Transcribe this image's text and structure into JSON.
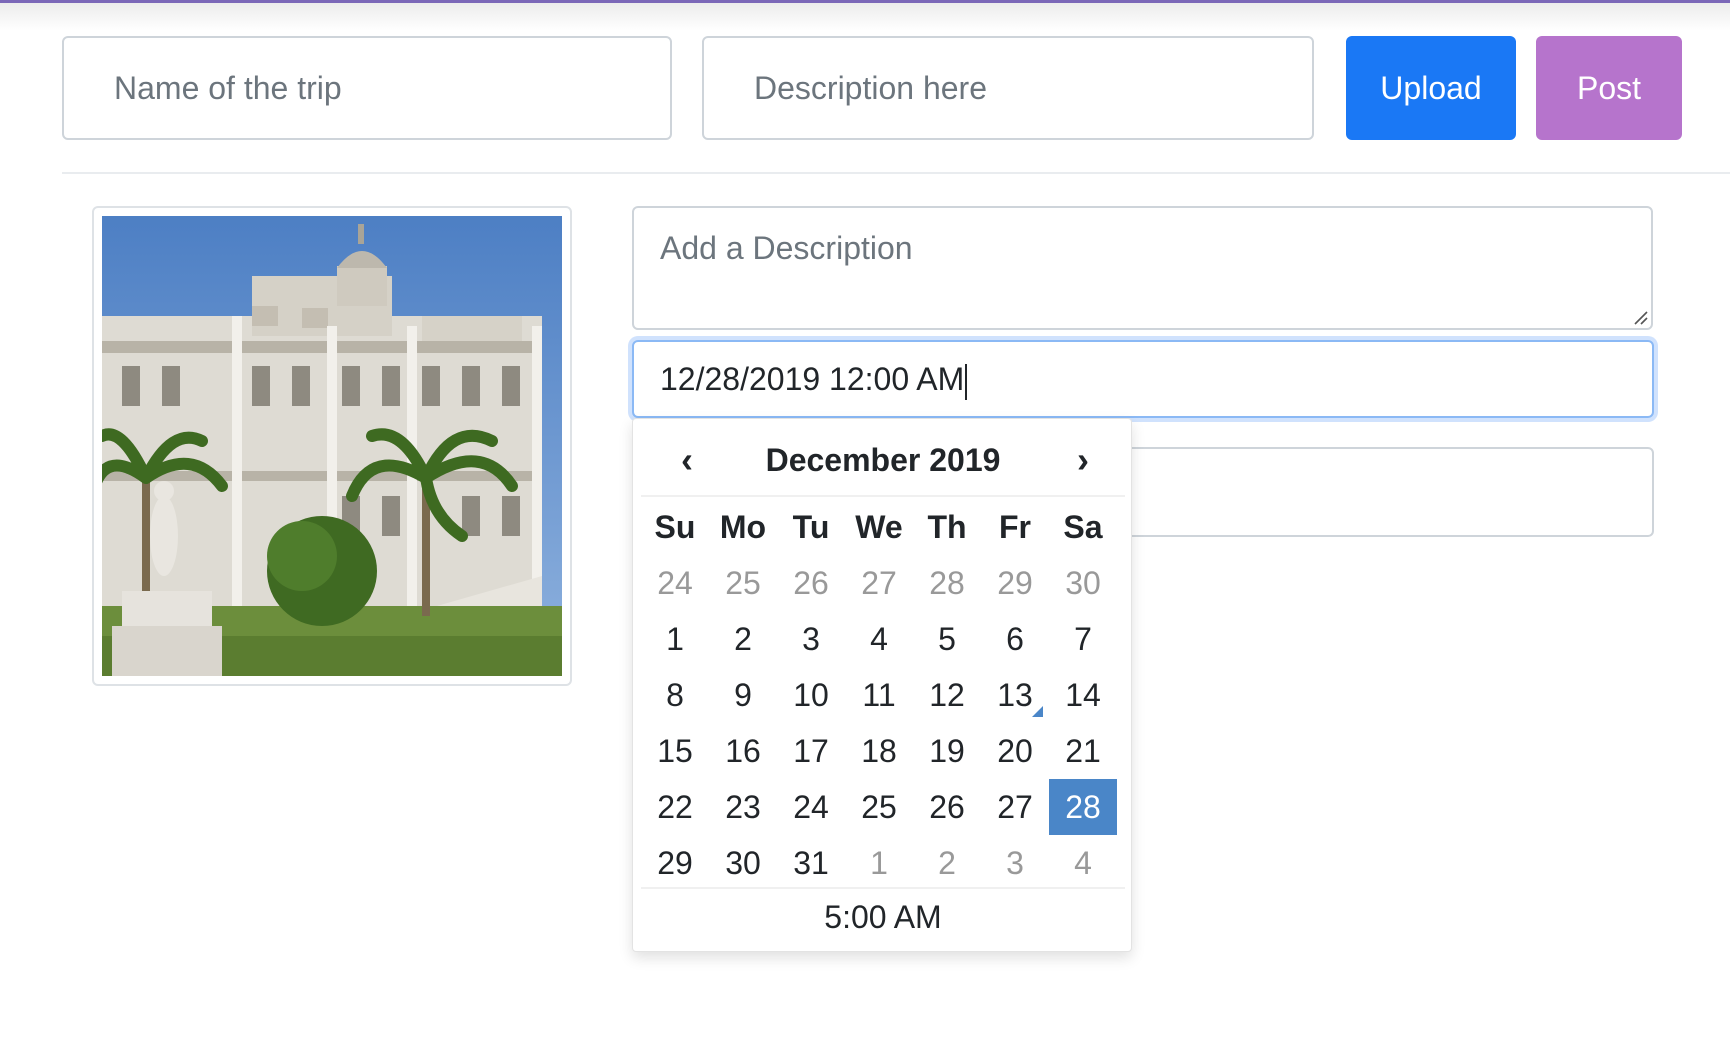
{
  "header": {
    "trip_name_placeholder": "Name of the trip",
    "trip_desc_placeholder": "Description here",
    "upload_label": "Upload",
    "post_label": "Post"
  },
  "colors": {
    "upload": "#1a78f5",
    "post": "#b674cc",
    "accent": "#4a86c8"
  },
  "form": {
    "description_placeholder": "Add a Description",
    "date_value": "12/28/2019 12:00 AM"
  },
  "datepicker": {
    "prev_icon": "chevron-left-icon",
    "next_icon": "chevron-right-icon",
    "prev": "‹",
    "next": "›",
    "month_label": "December 2019",
    "weekdays": [
      "Su",
      "Mo",
      "Tu",
      "We",
      "Th",
      "Fr",
      "Sa"
    ],
    "weeks": [
      [
        "24",
        "25",
        "26",
        "27",
        "28",
        "29",
        "30"
      ],
      [
        "1",
        "2",
        "3",
        "4",
        "5",
        "6",
        "7"
      ],
      [
        "8",
        "9",
        "10",
        "11",
        "12",
        "13",
        "14"
      ],
      [
        "15",
        "16",
        "17",
        "18",
        "19",
        "20",
        "21"
      ],
      [
        "22",
        "23",
        "24",
        "25",
        "26",
        "27",
        "28"
      ],
      [
        "29",
        "30",
        "31",
        "1",
        "2",
        "3",
        "4"
      ]
    ],
    "today": "13",
    "selected": "28",
    "time": "5:00 AM"
  }
}
